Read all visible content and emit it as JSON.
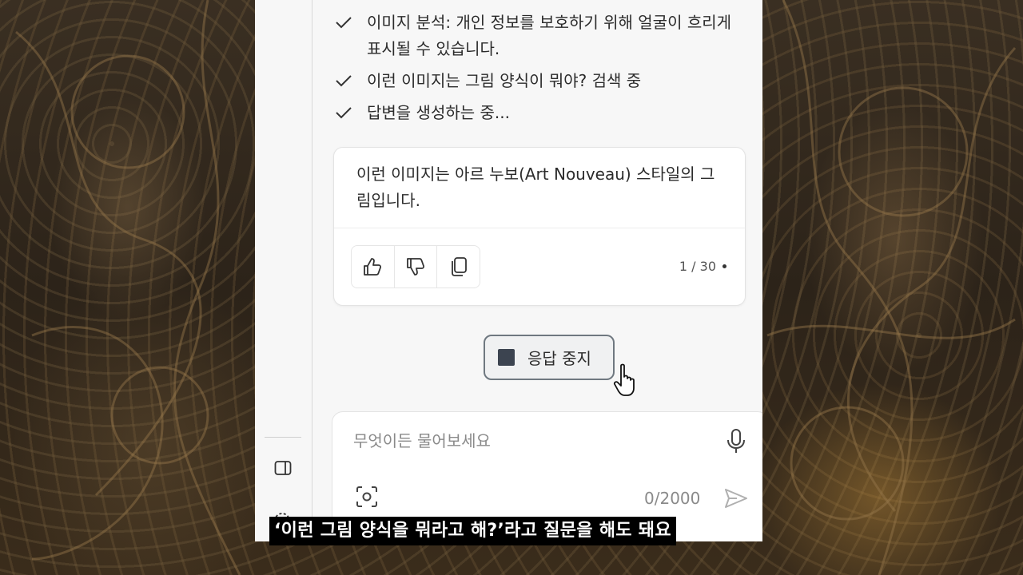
{
  "steps": [
    {
      "text": "이미지 분석: 개인 정보를 보호하기 위해 얼굴이 흐리게 표시될 수 있습니다.",
      "icon": "check-icon"
    },
    {
      "text": "이런 이미지는 그림 양식이 뭐야? 검색 중",
      "icon": "check-icon"
    },
    {
      "text": "답변을 생성하는 중...",
      "icon": "check-icon"
    }
  ],
  "answer": {
    "text": "이런 이미지는 아르 누보(Art Nouveau) 스타일의 그림입니다.",
    "counter": "1 / 30",
    "actions": [
      "thumbs-up-icon",
      "thumbs-down-icon",
      "copy-icon"
    ]
  },
  "stop_button": {
    "label": "응답 중지",
    "icon": "stop-icon"
  },
  "composer": {
    "placeholder": "무엇이든 물어보세요",
    "char_count": "0/2000",
    "icons": [
      "mic-icon",
      "screenshot-icon",
      "send-icon"
    ]
  },
  "rail": {
    "icons": [
      "sidebar-panel-icon",
      "gear-icon"
    ]
  },
  "caption": "‘이런 그림 양식을 뭐라고 해?’라고 질문을 해도 돼요",
  "colors": {
    "panel_bg": "#f7f7f7",
    "card_bg": "#ffffff",
    "stop_square": "#3c4450",
    "caption_bg": "#000000"
  }
}
